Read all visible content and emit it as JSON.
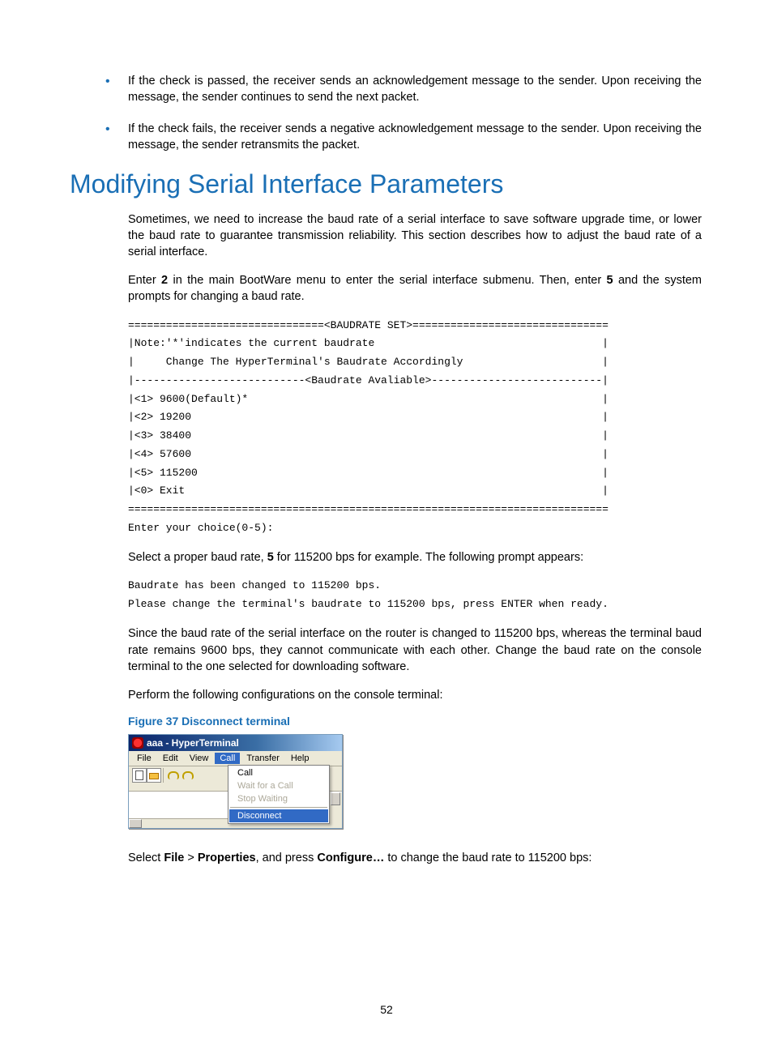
{
  "bullets": [
    "If the check is passed, the receiver sends an acknowledgement message to the sender. Upon receiving the message, the sender continues to send the next packet.",
    "If the check fails, the receiver sends a negative acknowledgement message to the sender. Upon receiving the message, the sender retransmits the packet."
  ],
  "heading": "Modifying Serial Interface Parameters",
  "intro": "Sometimes, we need to increase the baud rate of a serial interface to save software upgrade time, or lower the baud rate to guarantee transmission reliability. This section describes how to adjust the baud rate of a serial interface.",
  "enter_2_pre": "Enter ",
  "enter_2_num": "2",
  "enter_2_mid": " in the main BootWare menu to enter the serial interface submenu. Then, enter ",
  "enter_5_num": "5",
  "enter_2_post": " and the system prompts for changing a baud rate.",
  "terminal1": "===============================<BAUDRATE SET>===============================\n|Note:'*'indicates the current baudrate                                    |\n|     Change The HyperTerminal's Baudrate Accordingly                      |\n|---------------------------<Baudrate Avaliable>---------------------------|\n|<1> 9600(Default)*                                                        |\n|<2> 19200                                                                 |\n|<3> 38400                                                                 |\n|<4> 57600                                                                 |\n|<5> 115200                                                                |\n|<0> Exit                                                                  |\n============================================================================\nEnter your choice(0-5):",
  "select_pre": "Select a proper baud rate, ",
  "select_bold": "5",
  "select_post": " for 115200 bps for example. The following prompt appears:",
  "terminal2": "Baudrate has been changed to 115200 bps.\nPlease change the terminal's baudrate to 115200 bps, press ENTER when ready.",
  "since_text": "Since the baud rate of the serial interface on the router is changed to 115200 bps, whereas the terminal baud rate remains 9600 bps, they cannot communicate with each other. Change the baud rate on the console terminal to the one selected for downloading software.",
  "perform_text": "Perform the following configurations on the console terminal:",
  "figure_caption": "Figure 37 Disconnect terminal",
  "hyperterminal": {
    "title": "aaa - HyperTerminal",
    "menus": [
      "File",
      "Edit",
      "View",
      "Call",
      "Transfer",
      "Help"
    ],
    "dropdown": {
      "call": "Call",
      "wait": "Wait for a Call",
      "stop": "Stop Waiting",
      "disconnect": "Disconnect"
    }
  },
  "closing": {
    "a": "Select ",
    "b": "File",
    "c": " > ",
    "d": "Properties",
    "e": ", and press ",
    "f": "Configure…",
    "g": " to change the baud rate to 115200 bps:"
  },
  "page_number": "52"
}
